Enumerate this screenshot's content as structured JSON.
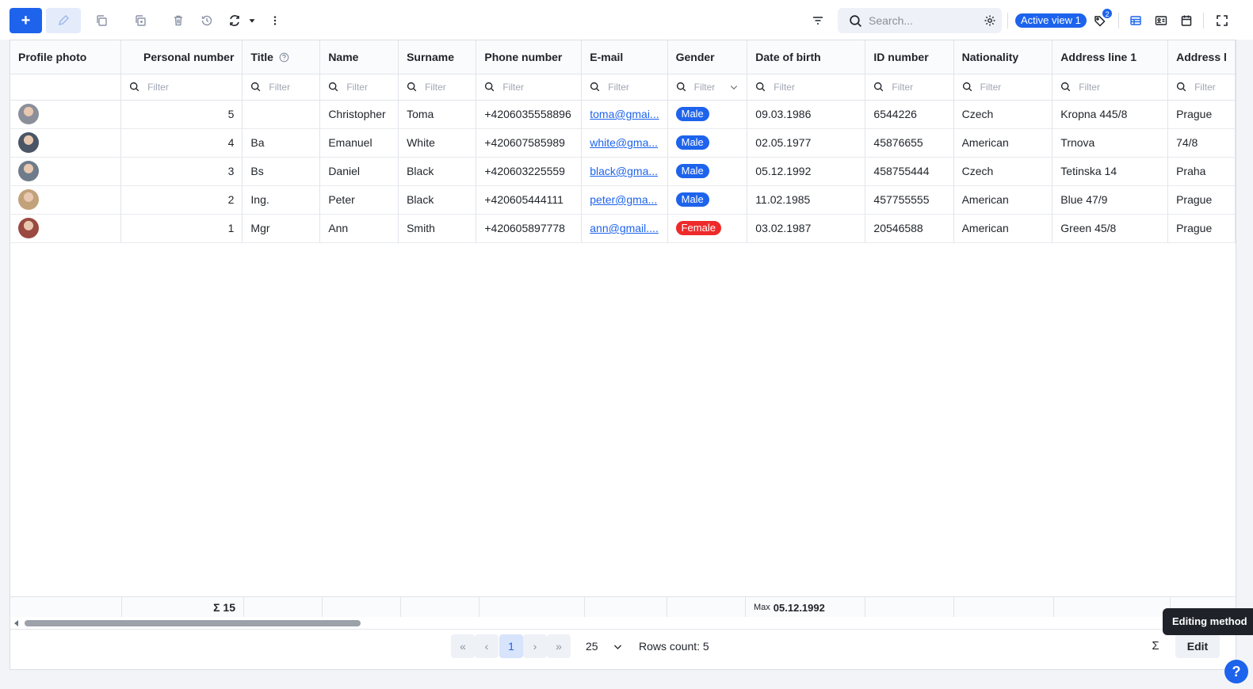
{
  "toolbar": {
    "add_label": "+",
    "search_placeholder": "Search...",
    "active_view": "Active view 1",
    "tags_badge": "2"
  },
  "columns": [
    {
      "key": "photo",
      "label": "Profile photo"
    },
    {
      "key": "personal_number",
      "label": "Personal number"
    },
    {
      "key": "title",
      "label": "Title"
    },
    {
      "key": "name",
      "label": "Name"
    },
    {
      "key": "surname",
      "label": "Surname"
    },
    {
      "key": "phone",
      "label": "Phone number"
    },
    {
      "key": "email",
      "label": "E-mail"
    },
    {
      "key": "gender",
      "label": "Gender"
    },
    {
      "key": "dob",
      "label": "Date of birth"
    },
    {
      "key": "id_number",
      "label": "ID number"
    },
    {
      "key": "nationality",
      "label": "Nationality"
    },
    {
      "key": "address1",
      "label": "Address line 1"
    },
    {
      "key": "address2",
      "label": "Address l"
    }
  ],
  "filter_placeholder": "Filter",
  "rows": [
    {
      "personal_number": "5",
      "title": "",
      "name": "Christopher",
      "surname": "Toma",
      "phone": "+4206035558896",
      "email": "toma@gmai...",
      "gender": "Male",
      "dob": "09.03.1986",
      "id_number": "6544226",
      "nationality": "Czech",
      "address1": "Kropna 445/8",
      "address2": "Prague"
    },
    {
      "personal_number": "4",
      "title": "Ba",
      "name": "Emanuel",
      "surname": "White",
      "phone": "+420607585989",
      "email": "white@gma...",
      "gender": "Male",
      "dob": "02.05.1977",
      "id_number": "45876655",
      "nationality": "American",
      "address1": "Trnova",
      "address2": "74/8"
    },
    {
      "personal_number": "3",
      "title": "Bs",
      "name": "Daniel",
      "surname": "Black",
      "phone": "+420603225559",
      "email": "black@gma...",
      "gender": "Male",
      "dob": "05.12.1992",
      "id_number": "458755444",
      "nationality": "Czech",
      "address1": "Tetinska 14",
      "address2": "Praha"
    },
    {
      "personal_number": "2",
      "title": "Ing.",
      "name": "Peter",
      "surname": "Black",
      "phone": "+420605444111",
      "email": "peter@gma...",
      "gender": "Male",
      "dob": "11.02.1985",
      "id_number": "457755555",
      "nationality": "American",
      "address1": "Blue 47/9",
      "address2": "Prague"
    },
    {
      "personal_number": "1",
      "title": "Mgr",
      "name": "Ann",
      "surname": "Smith",
      "phone": "+420605897778",
      "email": "ann@gmail....",
      "gender": "Female",
      "dob": "03.02.1987",
      "id_number": "20546588",
      "nationality": "American",
      "address1": "Green 45/8",
      "address2": "Prague"
    }
  ],
  "footer": {
    "sum_label": "Σ 15",
    "max_prefix": "Max",
    "max_value": "05.12.1992"
  },
  "pager": {
    "first": "«",
    "prev": "‹",
    "current": "1",
    "next": "›",
    "last": "»",
    "page_size": "25",
    "rows_count": "Rows count: 5",
    "sigma": "Σ",
    "edit_label": "Edit"
  },
  "tooltip": "Editing method",
  "help": "?",
  "colors": {
    "accent": "#1d63ec",
    "female": "#ee2a2a"
  }
}
